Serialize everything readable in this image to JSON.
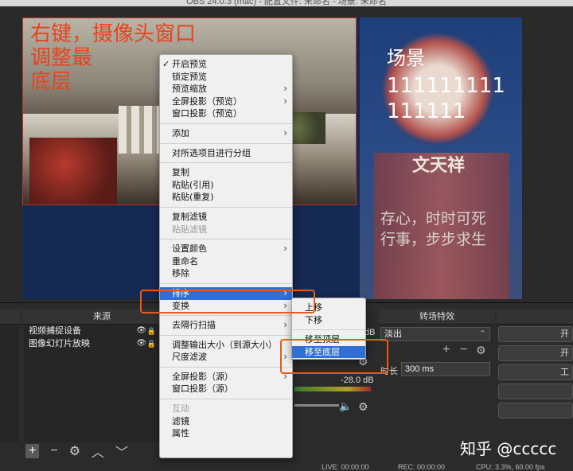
{
  "window": {
    "title": "OBS 24.0.3 (mac) - 配置文件: 未命名 - 场景: 未命名"
  },
  "preview": {
    "camera_note": [
      "右键，摄像头窗口",
      "调整最",
      "底层"
    ],
    "slide_title": "场景",
    "slide_number": "111111111111111",
    "slide_person": "文天祥",
    "slide_line1": "存心，时时可死",
    "slide_line2": "行事，步步求生"
  },
  "context_menu": {
    "groups": [
      [
        {
          "label": "开启预览",
          "checked": true,
          "submenu": false
        },
        {
          "label": "锁定预览",
          "submenu": false
        },
        {
          "label": "预览缩放",
          "submenu": true
        },
        {
          "label": "全屏投影（预览）",
          "submenu": true
        },
        {
          "label": "窗口投影（预览）",
          "submenu": false
        }
      ],
      [
        {
          "label": "添加",
          "submenu": true
        }
      ],
      [
        {
          "label": "对所选项目进行分组",
          "submenu": false
        }
      ],
      [
        {
          "label": "复制",
          "submenu": false
        },
        {
          "label": "粘贴(引用)",
          "submenu": false
        },
        {
          "label": "粘贴(重复)",
          "submenu": false
        }
      ],
      [
        {
          "label": "复制滤镜",
          "submenu": false
        },
        {
          "label": "粘贴滤镜",
          "submenu": false,
          "disabled": true
        }
      ],
      [
        {
          "label": "设置颜色",
          "submenu": true
        },
        {
          "label": "重命名",
          "submenu": false
        },
        {
          "label": "移除",
          "submenu": false
        }
      ],
      [
        {
          "label": "排序",
          "submenu": true,
          "highlighted": true
        },
        {
          "label": "变换",
          "submenu": true
        }
      ],
      [
        {
          "label": "去隔行扫描",
          "submenu": true
        }
      ],
      [
        {
          "label": "调整输出大小（到源大小）",
          "submenu": false
        },
        {
          "label": "尺度滤波",
          "submenu": true
        }
      ],
      [
        {
          "label": "全屏投影（源）",
          "submenu": true
        },
        {
          "label": "窗口投影（源）",
          "submenu": false
        }
      ],
      [
        {
          "label": "互动",
          "submenu": false,
          "disabled": true
        },
        {
          "label": "滤镜",
          "submenu": false
        },
        {
          "label": "属性",
          "submenu": false
        }
      ]
    ]
  },
  "order_submenu": {
    "items": [
      {
        "label": "上移"
      },
      {
        "label": "下移"
      },
      {
        "label": "移至顶层"
      },
      {
        "label": "移至底层",
        "highlighted": true
      }
    ]
  },
  "sources_dock": {
    "title": "来源",
    "items": [
      {
        "label": "视频捕捉设备"
      },
      {
        "label": "图像幻灯片放映"
      }
    ],
    "toolbar": [
      "+",
      "−",
      "⚙",
      "︿",
      "﹀"
    ]
  },
  "mixer": {
    "db_top": "dB",
    "db": "-28.0 dB"
  },
  "transitions_dock": {
    "title": "转场特效",
    "selected": "淡出",
    "duration_label": "时长",
    "duration_value": "300 ms"
  },
  "controls": {
    "buttons": [
      "开",
      "开",
      "工"
    ]
  },
  "status_bar": {
    "live": "LIVE: 00:00:00",
    "rec": "REC: 00:00:00",
    "cpu": "CPU: 3.3%, 60.00 fps"
  },
  "watermark": "知乎 @ccccc",
  "colors": {
    "accent": "#2f6fd6",
    "annotation": "#e85a1a",
    "canvas_bg": "#152a52"
  }
}
